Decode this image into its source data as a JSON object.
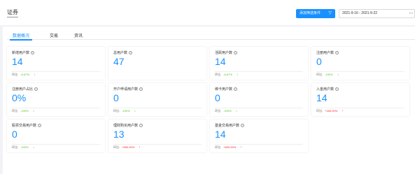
{
  "header": {
    "title": "证券",
    "filter_button_label": "添加筛选条件",
    "date_range": "2021-9-16 - 2021-9-22"
  },
  "tabs": [
    {
      "label": "数据概况",
      "active": true
    },
    {
      "label": "交易",
      "active": false
    },
    {
      "label": "资讯",
      "active": false
    }
  ],
  "change_label": "环比",
  "colors": {
    "accent": "#1890ff",
    "down": "#52c41a",
    "up": "#f5222d"
  },
  "cards": [
    {
      "label": "新增用户数",
      "value": "14",
      "change": "-6.67%",
      "direction": "down"
    },
    {
      "label": "总用户数",
      "value": "47",
      "change": "",
      "direction": ""
    },
    {
      "label": "活跃用户数",
      "value": "14",
      "change": "-6.67%",
      "direction": "down"
    },
    {
      "label": "注册用户数",
      "value": "0",
      "change": "-100%",
      "direction": "down"
    },
    {
      "label": "注册用户占比",
      "value": "0%",
      "change": "-100%",
      "direction": "down"
    },
    {
      "label": "开户申请用户数",
      "value": "0",
      "change": "-100%",
      "direction": "down"
    },
    {
      "label": "绑卡用户数",
      "value": "0",
      "change": "-100%",
      "direction": "down"
    },
    {
      "label": "入金用户数",
      "value": "14",
      "change": "+160.00%",
      "direction": "up"
    },
    {
      "label": "股票交易用户数",
      "value": "0",
      "change": "-100%",
      "direction": "down"
    },
    {
      "label": "理财购买用户数",
      "value": "13",
      "change": "+550.00%",
      "direction": "up"
    },
    {
      "label": "基金交易用户数",
      "value": "14",
      "change": "+600.00%",
      "direction": "up"
    }
  ]
}
